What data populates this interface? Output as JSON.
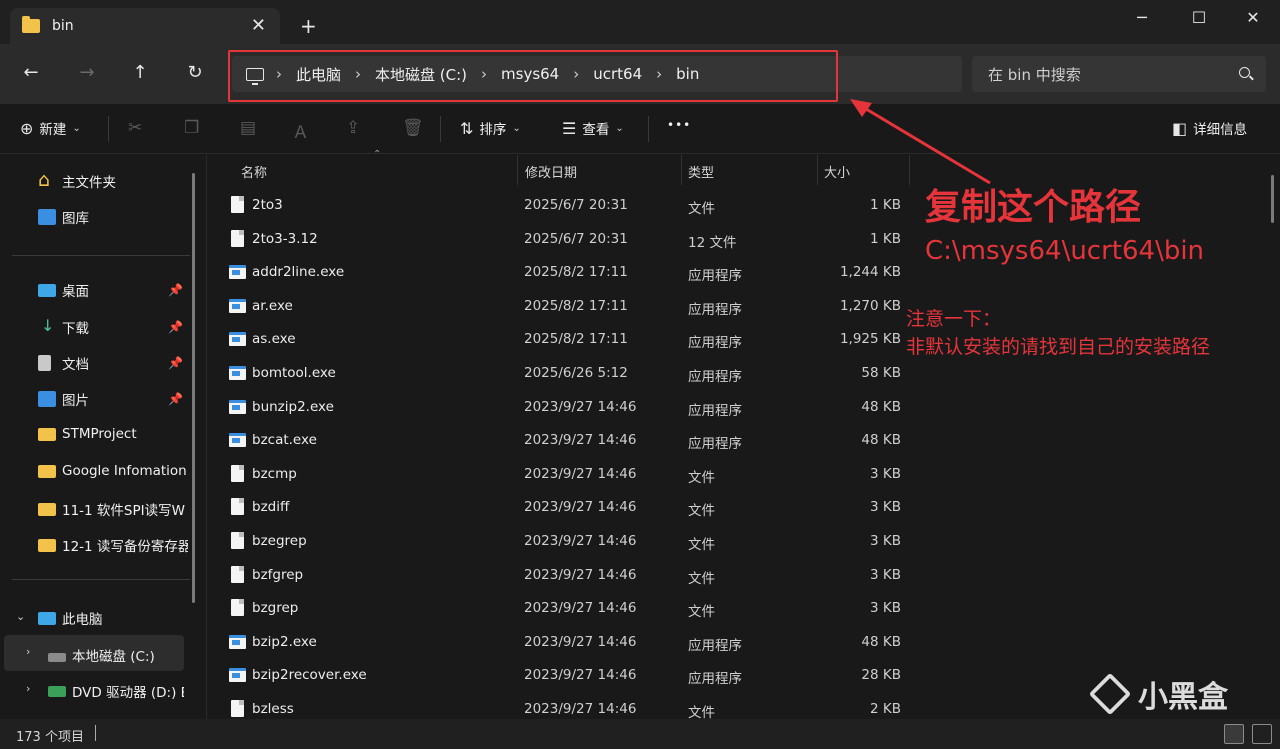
{
  "window": {
    "tab_title": "bin",
    "close_tab": "✕",
    "new_tab": "+",
    "minimize": "─",
    "maximize": "☐",
    "close": "✕"
  },
  "nav": {
    "back": "←",
    "forward": "→",
    "up": "↑",
    "refresh": "↻"
  },
  "breadcrumb": [
    "此电脑",
    "本地磁盘 (C:)",
    "msys64",
    "ucrt64",
    "bin"
  ],
  "breadcrumb_sep": "›",
  "search": {
    "placeholder": "在 bin 中搜索"
  },
  "toolbar": {
    "new_label": "新建",
    "sort_label": "排序",
    "view_label": "查看",
    "more_label": "•••",
    "details_label": "详细信息"
  },
  "sidebar": {
    "quick": [
      {
        "label": "主文件夹",
        "icon": "home-icon"
      },
      {
        "label": "图库",
        "icon": "gallery-icon"
      }
    ],
    "pinned": [
      {
        "label": "桌面",
        "icon": "desktop-icon"
      },
      {
        "label": "下载",
        "icon": "download-icon"
      },
      {
        "label": "文档",
        "icon": "document-icon"
      },
      {
        "label": "图片",
        "icon": "picture-icon"
      }
    ],
    "folders": [
      {
        "label": "STMProject"
      },
      {
        "label": "Google Infomation"
      },
      {
        "label": "11-1 软件SPI读写W"
      },
      {
        "label": "12-1 读写备份寄存器"
      }
    ],
    "this_pc": "此电脑",
    "drives": [
      {
        "label": "本地磁盘 (C:)"
      },
      {
        "label": "DVD 驱动器 (D:) ES"
      }
    ]
  },
  "columns": {
    "name": "名称",
    "date": "修改日期",
    "type": "类型",
    "size": "大小"
  },
  "files": [
    {
      "name": "2to3",
      "date": "2025/6/7 20:31",
      "type": "文件",
      "size": "1 KB",
      "icon": "file"
    },
    {
      "name": "2to3-3.12",
      "date": "2025/6/7 20:31",
      "type": "12 文件",
      "size": "1 KB",
      "icon": "file"
    },
    {
      "name": "addr2line.exe",
      "date": "2025/8/2 17:11",
      "type": "应用程序",
      "size": "1,244 KB",
      "icon": "exe"
    },
    {
      "name": "ar.exe",
      "date": "2025/8/2 17:11",
      "type": "应用程序",
      "size": "1,270 KB",
      "icon": "exe"
    },
    {
      "name": "as.exe",
      "date": "2025/8/2 17:11",
      "type": "应用程序",
      "size": "1,925 KB",
      "icon": "exe"
    },
    {
      "name": "bomtool.exe",
      "date": "2025/6/26 5:12",
      "type": "应用程序",
      "size": "58 KB",
      "icon": "exe"
    },
    {
      "name": "bunzip2.exe",
      "date": "2023/9/27 14:46",
      "type": "应用程序",
      "size": "48 KB",
      "icon": "exe"
    },
    {
      "name": "bzcat.exe",
      "date": "2023/9/27 14:46",
      "type": "应用程序",
      "size": "48 KB",
      "icon": "exe"
    },
    {
      "name": "bzcmp",
      "date": "2023/9/27 14:46",
      "type": "文件",
      "size": "3 KB",
      "icon": "file"
    },
    {
      "name": "bzdiff",
      "date": "2023/9/27 14:46",
      "type": "文件",
      "size": "3 KB",
      "icon": "file"
    },
    {
      "name": "bzegrep",
      "date": "2023/9/27 14:46",
      "type": "文件",
      "size": "3 KB",
      "icon": "file"
    },
    {
      "name": "bzfgrep",
      "date": "2023/9/27 14:46",
      "type": "文件",
      "size": "3 KB",
      "icon": "file"
    },
    {
      "name": "bzgrep",
      "date": "2023/9/27 14:46",
      "type": "文件",
      "size": "3 KB",
      "icon": "file"
    },
    {
      "name": "bzip2.exe",
      "date": "2023/9/27 14:46",
      "type": "应用程序",
      "size": "48 KB",
      "icon": "exe"
    },
    {
      "name": "bzip2recover.exe",
      "date": "2023/9/27 14:46",
      "type": "应用程序",
      "size": "28 KB",
      "icon": "exe"
    },
    {
      "name": "bzless",
      "date": "2023/9/27 14:46",
      "type": "文件",
      "size": "2 KB",
      "icon": "file"
    }
  ],
  "annotation": {
    "title": "复制这个路径",
    "path": "C:\\msys64\\ucrt64\\bin",
    "note_line1": "注意一下：",
    "note_line2": "非默认安装的请找到自己的安装路径",
    "color": "#e5343a"
  },
  "status": {
    "item_count": "173 个项目"
  },
  "watermark": {
    "text": "小黑盒"
  }
}
